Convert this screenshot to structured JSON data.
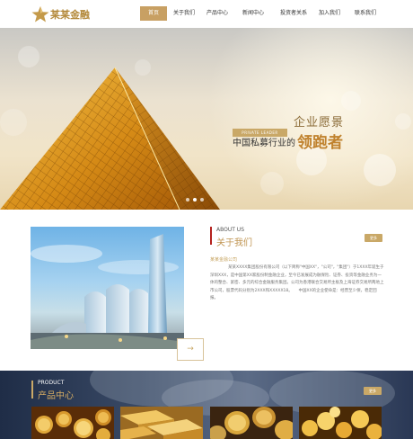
{
  "brand": {
    "logo_text": "某某金融",
    "accent": "#c8a063"
  },
  "nav": {
    "items": [
      {
        "label": "首页",
        "active": true
      },
      {
        "label": "关于我们",
        "active": false
      },
      {
        "label": "产品中心",
        "active": false
      },
      {
        "label": "新闻中心",
        "active": false
      },
      {
        "label": "投资者关系",
        "active": false
      },
      {
        "label": "加入我们",
        "active": false
      },
      {
        "label": "联系我们",
        "active": false
      }
    ]
  },
  "banner": {
    "badge": "PRIVATE LEADER",
    "slogan_top": "企业愿景",
    "slogan_main": "中国私募行业的",
    "slogan_big": "领跑者"
  },
  "about": {
    "title_en": "ABOUT US",
    "title_zh": "关于我们",
    "more_label": "更多",
    "subtitle": "某某金融公司",
    "body": "某某XXXX集团股份有限公司（以下简称\"中国XX\"，\"公司\"，\"集团\"）于1XXX年诞生于深圳XXX，是中国第XX家股份制金融企业，至今已发展成为融保险、证券、投资等金融业务为一体的整合、紧密、多元的综合金融服务集团。公司为香港联合交易所主板及上海证券交易所两地上市公司，股票代码分别为2XXX和XXXXX18。　　中国XX的企业使命是：经营至少保，稳定回报。"
  },
  "products": {
    "title_en": "PRODUCT",
    "title_zh": "产品中心",
    "more_label": "更多"
  }
}
